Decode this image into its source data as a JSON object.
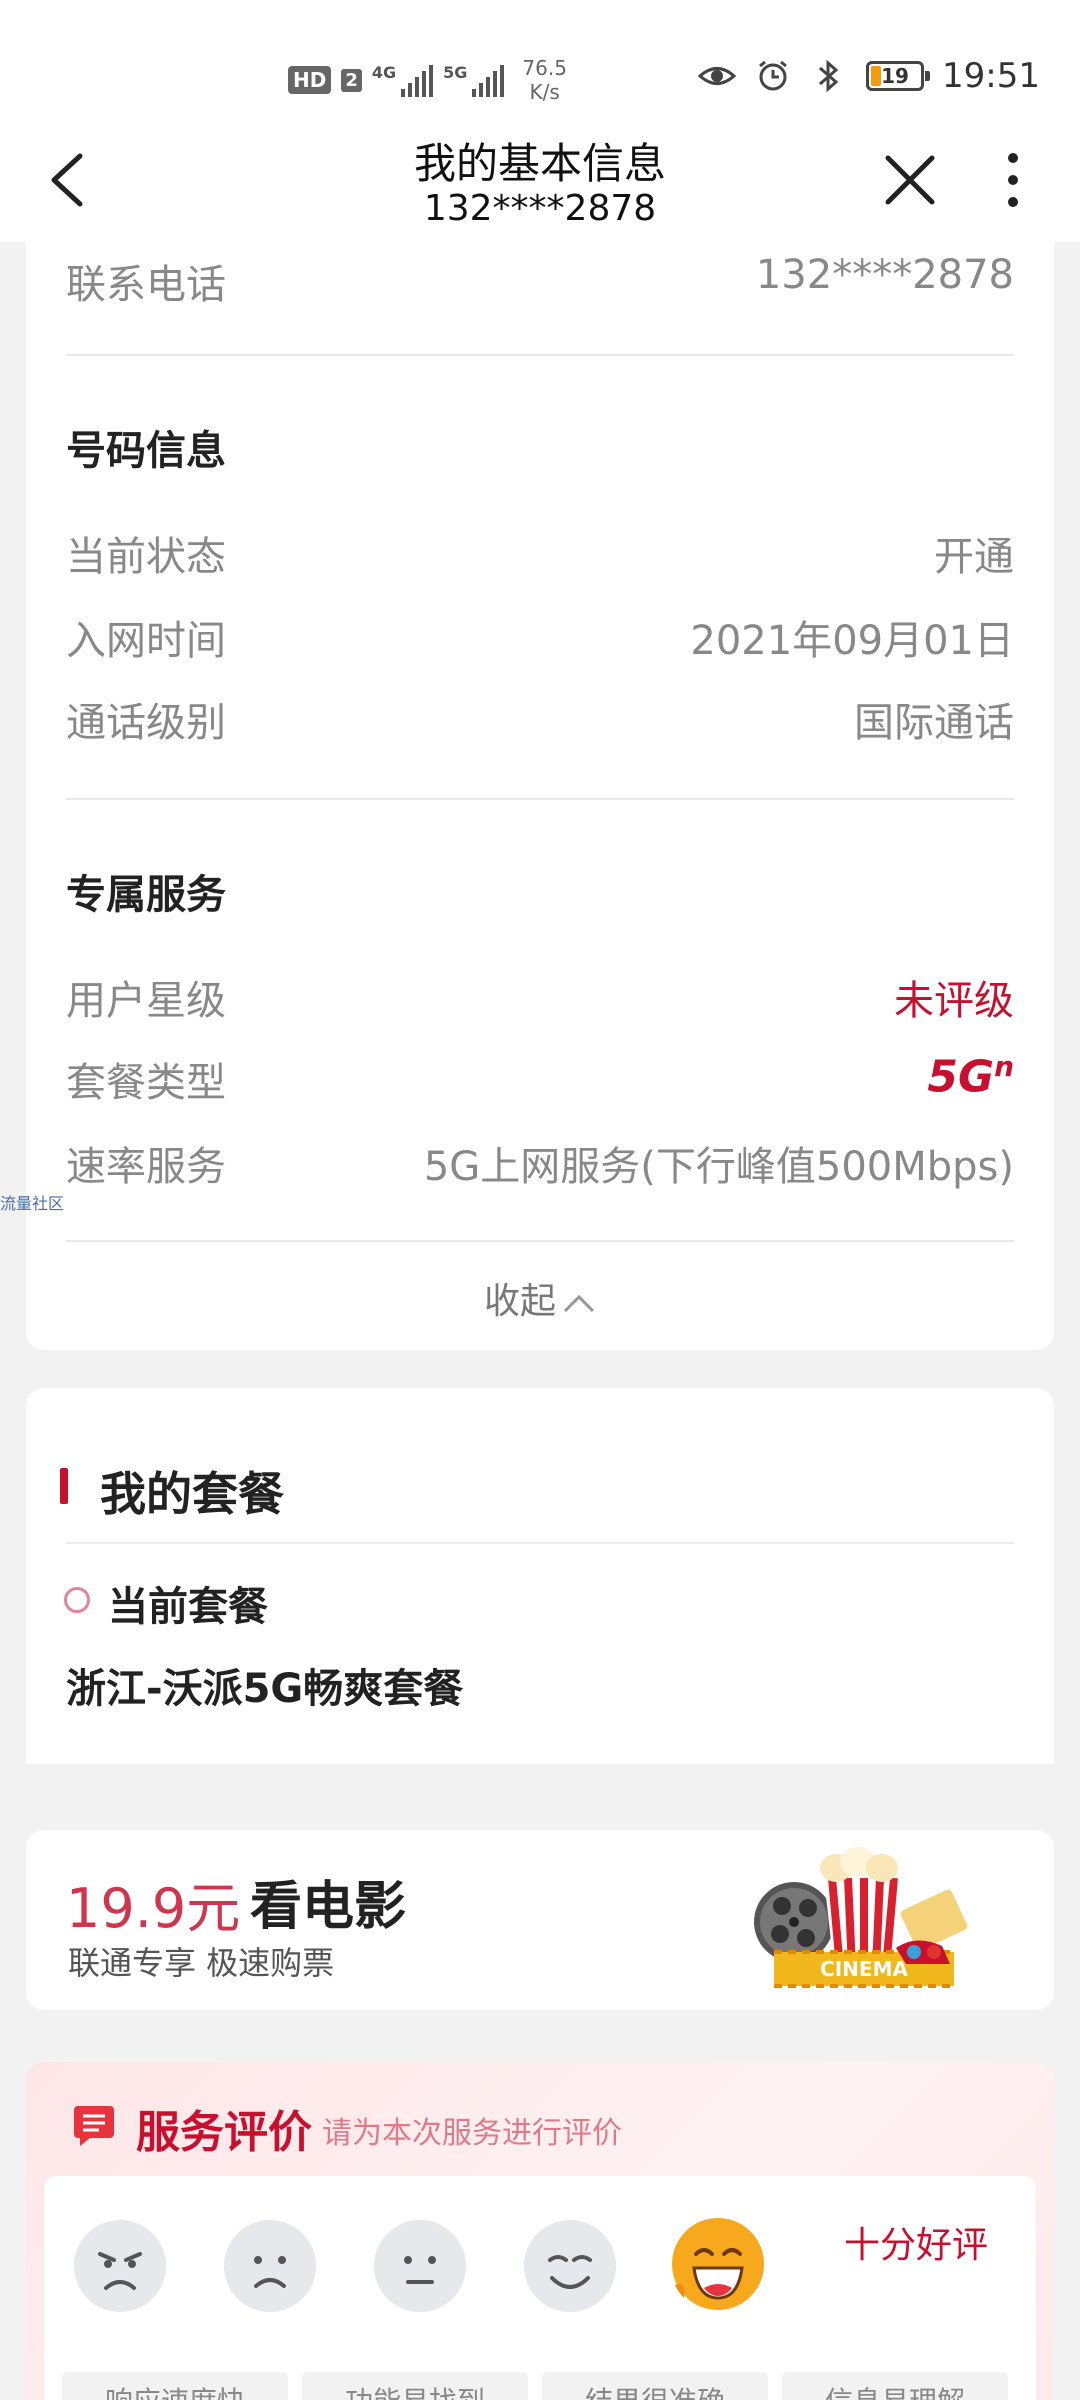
{
  "status_bar": {
    "hd": "HD",
    "sim": "2",
    "net1": "4G",
    "net2": "5G",
    "speed_value": "76.5",
    "speed_unit": "K/s",
    "battery": "19",
    "battery_level": 0.19,
    "time": "19:51"
  },
  "header": {
    "title": "我的基本信息",
    "subtitle": "132****2878"
  },
  "contact": {
    "label": "联系电话",
    "value": "132****2878"
  },
  "number_info": {
    "title": "号码信息",
    "rows": [
      {
        "label": "当前状态",
        "value": "开通"
      },
      {
        "label": "入网时间",
        "value": "2021年09月01日"
      },
      {
        "label": "通话级别",
        "value": "国际通话"
      }
    ]
  },
  "exclusive": {
    "title": "专属服务",
    "star_label": "用户星级",
    "star_value": "未评级",
    "plan_type_label": "套餐类型",
    "plan_type_logo": "5G",
    "plan_type_sup": "n",
    "rate_label": "速率服务",
    "rate_value": "5G上网服务(下行峰值500Mbps)"
  },
  "collapse_label": "收起",
  "floating_link": "流量社区",
  "my_plan": {
    "title": "我的套餐",
    "current_label": "当前套餐",
    "current_name": "浙江-沃派5G畅爽套餐"
  },
  "movie": {
    "price": "19.9元",
    "title": "看电影",
    "subtitle": "联通专享 极速购票",
    "art_text": "CINEMA"
  },
  "evaluation": {
    "title": "服务评价",
    "hint": "请为本次服务进行评价",
    "selected_label": "十分好评",
    "tags": [
      "响应速度快",
      "功能易找到",
      "结果很准确",
      "信息易理解"
    ]
  },
  "colors": {
    "accent": "#c8102e",
    "background": "#f2f2f2"
  }
}
